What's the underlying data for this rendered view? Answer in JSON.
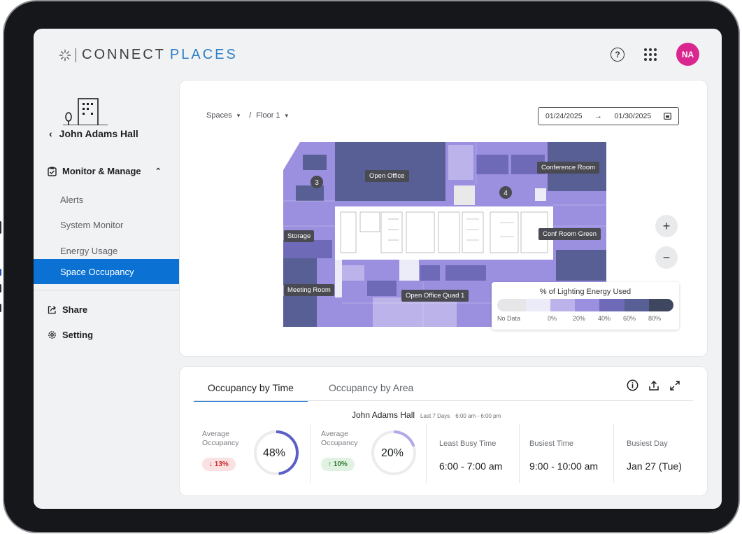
{
  "header": {
    "brand_part1": "CONNECT",
    "brand_part2": "PLACES",
    "help_icon": "help-circle-icon",
    "apps_icon": "apps-grid-icon",
    "avatar_initials": "NA",
    "avatar_color": "#d9278f"
  },
  "sidebar": {
    "building_icon": "building-icon",
    "building_name": "John Adams Hall",
    "section_label": "Monitor & Manage",
    "sub_items": [
      "Alerts",
      "System Monitor",
      "Energy Usage",
      "Space Occupancy"
    ],
    "active_item": "Space Occupancy",
    "share_label": "Share",
    "setting_label": "Setting",
    "accent_color": "#0b72d4"
  },
  "map": {
    "breadcrumb_spaces": "Spaces",
    "breadcrumb_sep": "/",
    "breadcrumb_floor": "Floor 1",
    "date_start": "01/24/2025",
    "date_arrow": "→",
    "date_end": "01/30/2025",
    "room_labels": {
      "open_office": "Open Office",
      "conference_room": "Conference Room",
      "storage": "Storage",
      "conf_room_green": "Conf Room Green",
      "meeting_room": "Meeting Room",
      "open_office_quad": "Open Office Quad 1"
    },
    "markers": [
      "3",
      "4"
    ],
    "zoom_in": "+",
    "zoom_out": "−",
    "legend": {
      "title": "% of Lighting Energy Used",
      "labels": [
        "No Data",
        "0%",
        "20%",
        "40%",
        "60%",
        "80%"
      ],
      "colors": [
        "#e6e6e8",
        "#ecebf8",
        "#bcb3ea",
        "#9b8fe0",
        "#6f6ab8",
        "#585f94",
        "#3f4660"
      ]
    }
  },
  "occupancy": {
    "tab_time": "Occupancy by Time",
    "tab_area": "Occupancy by Area",
    "building": "John Adams Hall",
    "period": "Last 7 Days",
    "hours": "6:00 am - 6:00 pm",
    "avg_label": "Average Occupancy",
    "avg1_value": "48%",
    "avg1_fraction": 0.48,
    "avg1_change": "↓ 13%",
    "avg2_value": "20%",
    "avg2_fraction": 0.2,
    "avg2_change": "↑ 10%",
    "least_busy_label": "Least Busy Time",
    "least_busy_value": "6:00 - 7:00 am",
    "busiest_time_label": "Busiest Time",
    "busiest_time_value": "9:00 - 10:00 am",
    "busiest_day_label": "Busiest Day",
    "busiest_day_value": "Jan 27 (Tue)"
  }
}
